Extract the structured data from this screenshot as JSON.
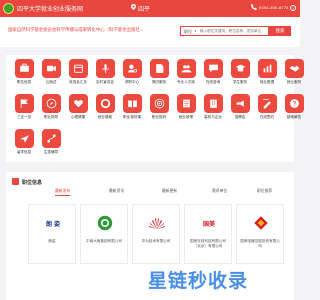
{
  "topbar": {
    "title": "四平大学就业创业服务网",
    "city": "四平",
    "phone": "0394-800-8776",
    "help_icon": "?"
  },
  "search": {
    "org": "国家自然科学基金委员会科学传播与成果转化中心（科学基金出版社...",
    "scope": "职位",
    "placeholder": "输入职位关键词、职位名称、发布单位",
    "button": "搜索"
  },
  "categories": [
    {
      "label": "职位信息",
      "icon": "briefcase"
    },
    {
      "label": "云面试",
      "icon": "video"
    },
    {
      "label": "双选会汇总",
      "icon": "calendar"
    },
    {
      "label": "实时宣讲会",
      "icon": "mic"
    },
    {
      "label": "求职中心",
      "icon": "user-search"
    },
    {
      "label": "简历服务",
      "icon": "document"
    },
    {
      "label": "专业人才库",
      "icon": "users"
    },
    {
      "label": "在线咨询",
      "icon": "chat"
    },
    {
      "label": "学生服务",
      "icon": "student"
    },
    {
      "label": "就业数据",
      "icon": "chart"
    },
    {
      "label": "就业服务",
      "icon": "handshake"
    },
    {
      "label": "三支一扶",
      "icon": "flag"
    },
    {
      "label": "职业指导",
      "icon": "compass"
    },
    {
      "label": "心理健康",
      "icon": "heart"
    },
    {
      "label": "就业援助",
      "icon": "lifebuoy"
    },
    {
      "label": "职业规划课",
      "icon": "book"
    },
    {
      "label": "职业规划",
      "icon": "target"
    },
    {
      "label": "就业政策",
      "icon": "scroll"
    },
    {
      "label": "高校与企业",
      "icon": "building"
    },
    {
      "label": "招聘会",
      "icon": "megaphone"
    },
    {
      "label": "在线签约",
      "icon": "sign"
    },
    {
      "label": "疑难解答",
      "icon": "question"
    },
    {
      "label": "留学信息",
      "icon": "plane"
    },
    {
      "label": "生涯辅导",
      "icon": "route"
    }
  ],
  "jobs": {
    "title": "职位信息",
    "tabs": [
      "最新发布",
      "最新资讯",
      "最新更新",
      "需求单位",
      "职位推荐"
    ],
    "active_tab": 0,
    "cards": [
      {
        "name": "朗姿",
        "logo": "brand-text-logo",
        "logo_text": "朗 姿"
      },
      {
        "name": "中南大局集团有限公司",
        "logo": "green-circle-logo"
      },
      {
        "name": "华为技术有限公司",
        "logo": "huawei-logo"
      },
      {
        "name": "国美在线科技有限公司（北京）有限公司",
        "logo": "red-text-logo",
        "logo_text": "国美"
      },
      {
        "name": "国美电器控股投资有限公司",
        "logo": "red-diamond-logo"
      }
    ]
  },
  "watermark": "星链秒收录",
  "colors": {
    "accent": "#e8463f",
    "watermark": "#4a8ee6"
  }
}
